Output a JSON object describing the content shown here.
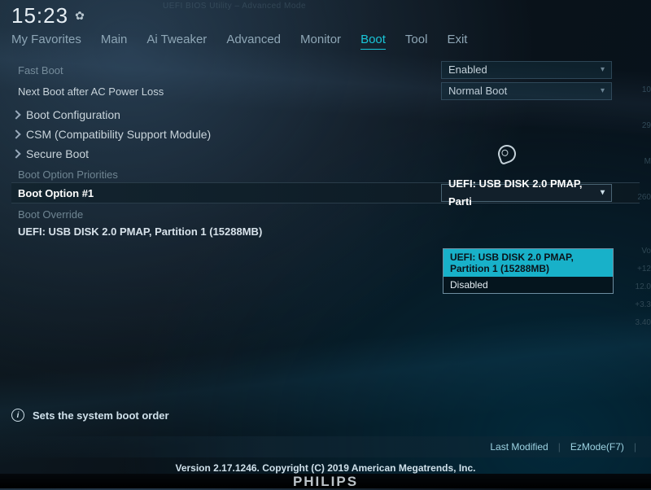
{
  "clock": "15:23",
  "tabs": [
    "My Favorites",
    "Main",
    "Ai Tweaker",
    "Advanced",
    "Monitor",
    "Boot",
    "Tool",
    "Exit"
  ],
  "active_tab_index": 5,
  "fast_boot": {
    "label": "Fast Boot",
    "value": "Enabled"
  },
  "next_boot": {
    "label": "Next Boot after AC Power Loss",
    "value": "Normal Boot"
  },
  "submenus": [
    "Boot Configuration",
    "CSM (Compatibility Support Module)",
    "Secure Boot"
  ],
  "priorities_header": "Boot Option Priorities",
  "boot_option": {
    "label": "Boot Option #1",
    "value": "UEFI:  USB DISK 2.0 PMAP, Parti",
    "options": [
      "UEFI:  USB DISK 2.0 PMAP, Partition 1 (15288MB)",
      "Disabled"
    ],
    "selected_index": 0
  },
  "override": {
    "header": "Boot Override",
    "item": "UEFI:  USB DISK 2.0 PMAP, Partition 1 (15288MB)"
  },
  "help_text": "Sets the system boot order",
  "bottom_bar": {
    "last_modified": "Last Modified",
    "ezmode": "EzMode(F7)"
  },
  "copyright": "Version 2.17.1246. Copyright (C) 2019 American Megatrends, Inc.",
  "monitor_brand": "PHILIPS"
}
